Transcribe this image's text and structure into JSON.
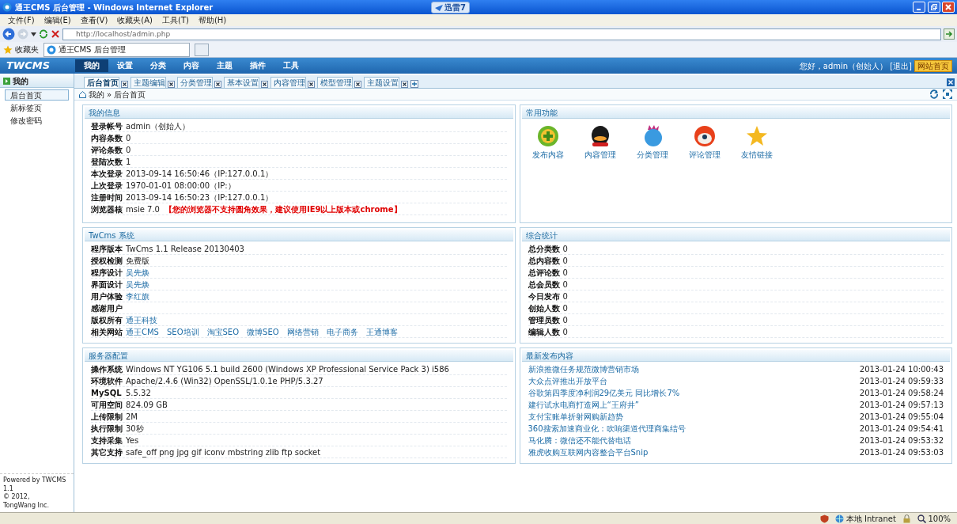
{
  "window": {
    "title": "通王CMS 后台管理 - Windows Internet Explorer",
    "badge": "迅雷7"
  },
  "menu": [
    "文件(F)",
    "编辑(E)",
    "查看(V)",
    "收藏夹(A)",
    "工具(T)",
    "帮助(H)"
  ],
  "address": {
    "value": "http://localhost/admin.php"
  },
  "favorites": {
    "label": "收藏夹"
  },
  "browser_tabs": [
    {
      "label": "通王CMS 后台管理",
      "selected": true
    }
  ],
  "app": {
    "logo": "TWCMS",
    "nav": [
      {
        "label": "我的",
        "selected": true
      },
      {
        "label": "设置",
        "selected": false
      },
      {
        "label": "分类",
        "selected": false
      },
      {
        "label": "内容",
        "selected": false
      },
      {
        "label": "主题",
        "selected": false
      },
      {
        "label": "插件",
        "selected": false
      },
      {
        "label": "工具",
        "selected": false
      }
    ],
    "user": {
      "greeting": "您好，admin（创始人）",
      "logout": "[退出]",
      "home": "网站首页"
    }
  },
  "sidebar": {
    "title": "我的",
    "items": [
      {
        "label": "后台首页",
        "selected": true
      },
      {
        "label": "新标签页",
        "selected": false
      },
      {
        "label": "修改密码",
        "selected": false
      }
    ],
    "footer": [
      {
        "before": "Powered by",
        "link": "TWCMS",
        "after": "1.1"
      },
      {
        "before": "© 2012,",
        "link": "TongWang Inc."
      }
    ]
  },
  "tabs": [
    {
      "label": "后台首页",
      "selected": true
    },
    {
      "label": "主题编辑",
      "selected": false
    },
    {
      "label": "分类管理",
      "selected": false
    },
    {
      "label": "基本设置",
      "selected": false
    },
    {
      "label": "内容管理",
      "selected": false
    },
    {
      "label": "模型管理",
      "selected": false
    },
    {
      "label": "主题设置",
      "selected": false
    }
  ],
  "breadcrumb": {
    "items": [
      "我的",
      "后台首页"
    ],
    "separator": "»"
  },
  "panels": [
    {
      "title": "我的信息",
      "kind": "info",
      "rows": [
        {
          "label": "登录帐号",
          "value": "admin（创始人）"
        },
        {
          "label": "内容条数",
          "value": "0"
        },
        {
          "label": "评论条数",
          "value": "0"
        },
        {
          "label": "登陆次数",
          "value": "1"
        },
        {
          "label": "本次登录",
          "value": "2013-09-14 16:50:46（IP:127.0.0.1）"
        },
        {
          "label": "上次登录",
          "value": "1970-01-01 08:00:00（IP:）"
        },
        {
          "label": "注册时间",
          "value": "2013-09-14 16:50:23（IP:127.0.0.1）"
        },
        {
          "label": "浏览器核",
          "value": "msie 7.0",
          "warning": "【您的浏览器不支持圆角效果，建议使用IE9以上版本或chrome】"
        }
      ]
    },
    {
      "title": "常用功能",
      "kind": "shortcuts",
      "items": [
        "发布内容",
        "内容管理",
        "分类管理",
        "评论管理",
        "友情链接"
      ]
    },
    {
      "title": "TwCms 系统",
      "kind": "info",
      "rows": [
        {
          "label": "程序版本",
          "value": "TwCms 1.1 Release 20130403"
        },
        {
          "label": "授权检测",
          "value": "免费版"
        },
        {
          "label": "程序设计",
          "links": [
            "吴先焕"
          ]
        },
        {
          "label": "界面设计",
          "links": [
            "吴先焕"
          ]
        },
        {
          "label": "用户体验",
          "links": [
            "李红旗"
          ]
        },
        {
          "label": "感谢用户"
        },
        {
          "label": "版权所有",
          "links": [
            "通王科技"
          ]
        },
        {
          "label": "相关网站",
          "links": [
            "通王CMS",
            "SEO培训",
            "淘宝SEO",
            "微博SEO",
            "网络营销",
            "电子商务",
            "王通博客"
          ]
        }
      ]
    },
    {
      "title": "综合统计",
      "kind": "info",
      "rows": [
        {
          "label": "总分类数",
          "value": "0"
        },
        {
          "label": "总内容数",
          "value": "0"
        },
        {
          "label": "总评论数",
          "value": "0"
        },
        {
          "label": "总会员数",
          "value": "0"
        },
        {
          "label": "今日发布",
          "value": "0"
        },
        {
          "label": "创始人数",
          "value": "0"
        },
        {
          "label": "管理员数",
          "value": "0"
        },
        {
          "label": "编辑人数",
          "value": "0"
        }
      ]
    },
    {
      "title": "服务器配置",
      "kind": "info",
      "rows": [
        {
          "label": "操作系统",
          "value": "Windows NT YG106 5.1 build 2600 (Windows XP Professional Service Pack 3) i586"
        },
        {
          "label": "环境软件",
          "value": "Apache/2.4.6 (Win32) OpenSSL/1.0.1e PHP/5.3.27"
        },
        {
          "label": "MySQL",
          "value": "5.5.32"
        },
        {
          "label": "可用空间",
          "value": "824.09 GB"
        },
        {
          "label": "上传限制",
          "value": "2M"
        },
        {
          "label": "执行限制",
          "value": "30秒"
        },
        {
          "label": "支持采集",
          "value": "Yes"
        },
        {
          "label": "其它支持",
          "value": "safe_off png jpg gif iconv mbstring zlib ftp socket"
        }
      ]
    },
    {
      "title": "最新发布内容",
      "kind": "news",
      "items": [
        {
          "title": "新浪推微任务规范微博营销市场",
          "date": "2013-01-24 10:00:43"
        },
        {
          "title": "大众点评推出开放平台",
          "date": "2013-01-24 09:59:33"
        },
        {
          "title": "谷歌第四季度净利润29亿美元 同比增长7%",
          "date": "2013-01-24 09:58:24"
        },
        {
          "title": "建行试水电商打造网上“王府井”",
          "date": "2013-01-24 09:57:13"
        },
        {
          "title": "支付宝账单折射网购新趋势",
          "date": "2013-01-24 09:55:04"
        },
        {
          "title": "360搜索加速商业化：吹响渠道代理商集结号",
          "date": "2013-01-24 09:54:41"
        },
        {
          "title": "马化腾：微信还不能代替电话",
          "date": "2013-01-24 09:53:32"
        },
        {
          "title": "雅虎收购互联网内容整合平台Snip",
          "date": "2013-01-24 09:53:03"
        }
      ]
    }
  ],
  "status_bar": {
    "zone": "本地 Intranet",
    "zoom": "100%"
  }
}
